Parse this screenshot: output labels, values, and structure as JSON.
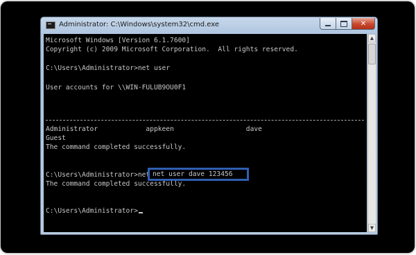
{
  "window": {
    "title": "Administrator: C:\\Windows\\system32\\cmd.exe",
    "controls": {
      "minimize": "minimize",
      "maximize": "maximize",
      "close": "✕"
    }
  },
  "console": {
    "lines": [
      "Microsoft Windows [Version 6.1.7600]",
      "Copyright (c) 2009 Microsoft Corporation.  All rights reserved.",
      "C:\\Users\\Administrator>net user",
      "User accounts for \\\\WIN-FULUB9OU0F1",
      "Administrator            appkeen                  dave",
      "Guest",
      "The command completed successfully.",
      "C:\\Users\\Administrator>net user dave 123456",
      "The command completed successfully.",
      "C:\\Users\\Administrator>"
    ],
    "highlighted_command": "net user dave 123456"
  },
  "icons": {
    "app": "cmd-icon",
    "scroll_up": "▲",
    "scroll_down": "▼"
  }
}
